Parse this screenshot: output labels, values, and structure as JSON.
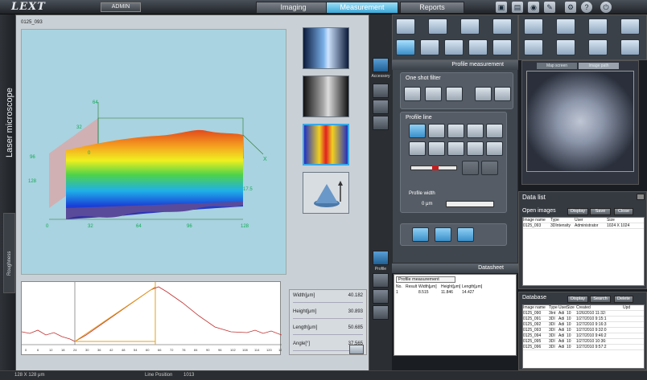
{
  "app": {
    "logo": "LEXT",
    "user": "ADMIN"
  },
  "tabs": [
    "Imaging",
    "Measurement",
    "Reports"
  ],
  "active_tab": "Measurement",
  "top_icons": [
    "disk-icon",
    "print-icon",
    "camera-icon",
    "tools-icon",
    "gear-icon",
    "help-icon",
    "power-icon"
  ],
  "left": {
    "vertical_label": "Laser microscope",
    "side_tab": "Roughness"
  },
  "image": {
    "filename": "0125_093",
    "axis_labels_3d": {
      "z_ticks": [
        "64",
        "32",
        "0"
      ],
      "x_ticks": [
        "0",
        "32",
        "64",
        "96",
        "128"
      ],
      "y_ticks": [
        "0",
        "96",
        "128"
      ],
      "right": "X",
      "depth": "17.5"
    }
  },
  "profile_axis": [
    "0",
    "6",
    "12",
    "18",
    "24",
    "30",
    "36",
    "42",
    "48",
    "54",
    "60",
    "66",
    "72",
    "78",
    "84",
    "90",
    "96",
    "102",
    "108",
    "114",
    "120",
    "126"
  ],
  "measurements": [
    {
      "label": "Width[μm]",
      "value": "40.182"
    },
    {
      "label": "Height[μm]",
      "value": "30.893"
    },
    {
      "label": "Length[μm]",
      "value": "50.685"
    },
    {
      "label": "Angle[°]",
      "value": "37.565"
    }
  ],
  "side_labels": {
    "accessory": "Accessory",
    "profile": "Profile"
  },
  "profile_panel": {
    "title": "Profile measurement",
    "filter_group": "One shot filter",
    "line_group": "Profile line",
    "width_label": "Profile width",
    "width_value": "0",
    "width_unit": "μm"
  },
  "datasheet": {
    "title": "Datasheet",
    "select": "Profile measurement",
    "columns": [
      "No.",
      "Result",
      "Width[μm]",
      "Height[μm]",
      "Length[μm]"
    ],
    "rows": [
      [
        "1",
        "",
        "8.515",
        "11.846",
        "14.427"
      ]
    ]
  },
  "map": {
    "tabs": [
      "Map screen",
      "Image path"
    ]
  },
  "data_list": {
    "title": "Data list",
    "open_images": "Open images",
    "buttons": [
      "Display",
      "Save",
      "Close"
    ],
    "columns": [
      "Image name",
      "Type",
      "User",
      "Size"
    ],
    "rows": [
      [
        "0125_093",
        "3DIntensity",
        "Administrator",
        "1024 X 1024"
      ]
    ]
  },
  "database": {
    "title": "Database",
    "buttons": [
      "Display",
      "Search",
      "Delete"
    ],
    "columns": [
      "Image name",
      "Type",
      "User",
      "Size",
      "Created",
      "Upd"
    ],
    "rows": [
      [
        "0125_090",
        "3Int",
        "Adi",
        "10",
        "1/26/2010 11:32:"
      ],
      [
        "0125_091",
        "3DI",
        "Adi",
        "10",
        "1/27/2010 9:15:1"
      ],
      [
        "0125_092",
        "3DI",
        "Adi",
        "10",
        "1/27/2010 9:16:3"
      ],
      [
        "0125_093",
        "3DI",
        "Adi",
        "10",
        "1/27/2010 9:32:0"
      ],
      [
        "0125_094",
        "3DI",
        "Adi",
        "10",
        "1/27/2010 9:46:2"
      ],
      [
        "0125_095",
        "3DI",
        "Adi",
        "10",
        "1/27/2010 10:36:"
      ],
      [
        "0125_096",
        "3DI",
        "Adi",
        "10",
        "1/27/2010 9:57:2"
      ]
    ]
  },
  "status": {
    "size": "128 X 128 μm",
    "mode": "Line Position",
    "value": "1013"
  }
}
